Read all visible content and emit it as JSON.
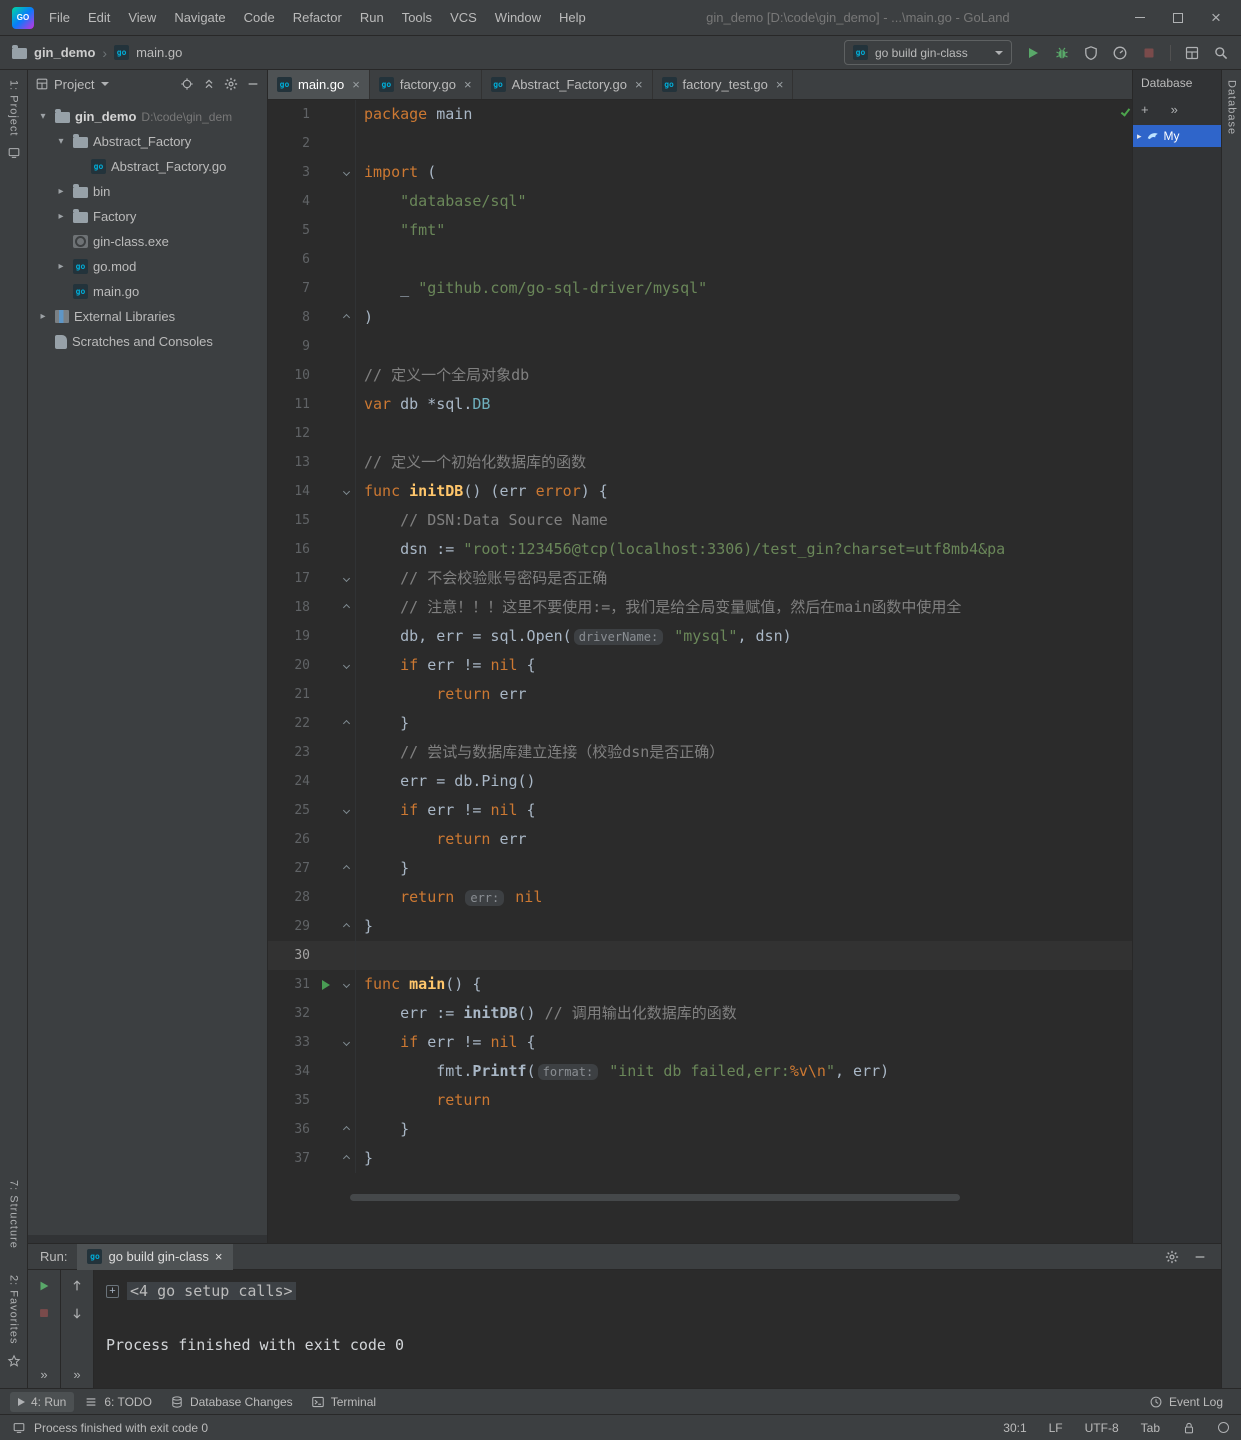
{
  "titlebar": {
    "menu": [
      "File",
      "Edit",
      "View",
      "Navigate",
      "Code",
      "Refactor",
      "Run",
      "Tools",
      "VCS",
      "Window",
      "Help"
    ],
    "title": "gin_demo [D:\\code\\gin_demo] - ...\\main.go - GoLand"
  },
  "toolbar": {
    "project_crumb": "gin_demo",
    "file_crumb": "main.go",
    "run_config": "go build gin-class"
  },
  "stripes": {
    "left_top": "1: Project",
    "left_structure": "7: Structure",
    "left_favorites": "2: Favorites",
    "right_database": "Database"
  },
  "project": {
    "header": "Project",
    "items": [
      {
        "label": "gin_demo",
        "hint": "D:\\code\\gin_dem",
        "icon": "folder",
        "arrow": "down",
        "indent": 0,
        "bold": true
      },
      {
        "label": "Abstract_Factory",
        "icon": "folder",
        "arrow": "down",
        "indent": 1
      },
      {
        "label": "Abstract_Factory.go",
        "icon": "gofile",
        "arrow": "none",
        "indent": 2
      },
      {
        "label": "bin",
        "icon": "folder",
        "arrow": "right",
        "indent": 1
      },
      {
        "label": "Factory",
        "icon": "folder",
        "arrow": "right",
        "indent": 1
      },
      {
        "label": "gin-class.exe",
        "icon": "exe",
        "arrow": "none",
        "indent": 1
      },
      {
        "label": "go.mod",
        "icon": "gomod",
        "arrow": "right",
        "indent": 1
      },
      {
        "label": "main.go",
        "icon": "gofile",
        "arrow": "none",
        "indent": 1
      },
      {
        "label": "External Libraries",
        "icon": "lib",
        "arrow": "right",
        "indent": 0
      },
      {
        "label": "Scratches and Consoles",
        "icon": "scratch",
        "arrow": "none",
        "indent": 0
      }
    ]
  },
  "editor": {
    "tabs": [
      {
        "label": "main.go",
        "active": true
      },
      {
        "label": "factory.go",
        "active": false
      },
      {
        "label": "Abstract_Factory.go",
        "active": false
      },
      {
        "label": "factory_test.go",
        "active": false
      }
    ],
    "lines": [
      {
        "n": 1,
        "seg": [
          [
            "kw",
            "package"
          ],
          [
            "plain",
            " main"
          ]
        ]
      },
      {
        "n": 2,
        "seg": []
      },
      {
        "n": 3,
        "fold": "start",
        "seg": [
          [
            "kw",
            "import"
          ],
          [
            "plain",
            " ("
          ]
        ]
      },
      {
        "n": 4,
        "seg": [
          [
            "plain",
            "    "
          ],
          [
            "str",
            "\"database/sql\""
          ]
        ]
      },
      {
        "n": 5,
        "seg": [
          [
            "plain",
            "    "
          ],
          [
            "str",
            "\"fmt\""
          ]
        ]
      },
      {
        "n": 6,
        "seg": []
      },
      {
        "n": 7,
        "seg": [
          [
            "plain",
            "    _ "
          ],
          [
            "str",
            "\"github.com/go-sql-driver/mysql\""
          ]
        ]
      },
      {
        "n": 8,
        "fold": "end",
        "seg": [
          [
            "plain",
            ")"
          ]
        ]
      },
      {
        "n": 9,
        "seg": []
      },
      {
        "n": 10,
        "seg": [
          [
            "com",
            "// 定义一个全局对象db"
          ]
        ]
      },
      {
        "n": 11,
        "seg": [
          [
            "kw",
            "var"
          ],
          [
            "plain",
            " db *sql."
          ],
          [
            "typ",
            "DB"
          ]
        ]
      },
      {
        "n": 12,
        "seg": []
      },
      {
        "n": 13,
        "seg": [
          [
            "com",
            "// 定义一个初始化数据库的函数"
          ]
        ]
      },
      {
        "n": 14,
        "fold": "start",
        "seg": [
          [
            "kw",
            "func"
          ],
          [
            "plain",
            " "
          ],
          [
            "fn",
            "initDB"
          ],
          [
            "plain",
            "() (err "
          ],
          [
            "kw",
            "error"
          ],
          [
            "plain",
            ") {"
          ]
        ]
      },
      {
        "n": 15,
        "seg": [
          [
            "plain",
            "    "
          ],
          [
            "com",
            "// DSN:Data Source Name"
          ]
        ]
      },
      {
        "n": 16,
        "seg": [
          [
            "plain",
            "    dsn := "
          ],
          [
            "str",
            "\"root:123456@tcp(localhost:3306)/test_gin?charset=utf8mb4&pa"
          ]
        ]
      },
      {
        "n": 17,
        "fold": "start",
        "seg": [
          [
            "plain",
            "    "
          ],
          [
            "com",
            "// 不会校验账号密码是否正确"
          ]
        ]
      },
      {
        "n": 18,
        "fold": "end",
        "seg": [
          [
            "plain",
            "    "
          ],
          [
            "com",
            "// 注意！！！这里不要使用:=，我们是给全局变量赋值，然后在main函数中使用全"
          ]
        ]
      },
      {
        "n": 19,
        "seg": [
          [
            "plain",
            "    db, err = sql.Open("
          ],
          [
            "hint",
            "driverName:"
          ],
          [
            "plain",
            " "
          ],
          [
            "str",
            "\"mysql\""
          ],
          [
            "plain",
            ", dsn)"
          ]
        ]
      },
      {
        "n": 20,
        "fold": "start",
        "seg": [
          [
            "plain",
            "    "
          ],
          [
            "kw",
            "if"
          ],
          [
            "plain",
            " err != "
          ],
          [
            "kw",
            "nil"
          ],
          [
            "plain",
            " {"
          ]
        ]
      },
      {
        "n": 21,
        "seg": [
          [
            "plain",
            "        "
          ],
          [
            "kw",
            "return"
          ],
          [
            "plain",
            " err"
          ]
        ]
      },
      {
        "n": 22,
        "fold": "end",
        "seg": [
          [
            "plain",
            "    }"
          ]
        ]
      },
      {
        "n": 23,
        "seg": [
          [
            "plain",
            "    "
          ],
          [
            "com",
            "// 尝试与数据库建立连接（校验dsn是否正确）"
          ]
        ]
      },
      {
        "n": 24,
        "seg": [
          [
            "plain",
            "    err = db.Ping()"
          ]
        ]
      },
      {
        "n": 25,
        "fold": "start",
        "seg": [
          [
            "plain",
            "    "
          ],
          [
            "kw",
            "if"
          ],
          [
            "plain",
            " err != "
          ],
          [
            "kw",
            "nil"
          ],
          [
            "plain",
            " {"
          ]
        ]
      },
      {
        "n": 26,
        "seg": [
          [
            "plain",
            "        "
          ],
          [
            "kw",
            "return"
          ],
          [
            "plain",
            " err"
          ]
        ]
      },
      {
        "n": 27,
        "fold": "end",
        "seg": [
          [
            "plain",
            "    }"
          ]
        ]
      },
      {
        "n": 28,
        "seg": [
          [
            "plain",
            "    "
          ],
          [
            "kw",
            "return"
          ],
          [
            "plain",
            " "
          ],
          [
            "hint",
            "err:"
          ],
          [
            "plain",
            " "
          ],
          [
            "kw",
            "nil"
          ]
        ]
      },
      {
        "n": 29,
        "fold": "end",
        "seg": [
          [
            "plain",
            "}"
          ]
        ]
      },
      {
        "n": 30,
        "caret": true,
        "seg": []
      },
      {
        "n": 31,
        "fold": "start",
        "run": true,
        "seg": [
          [
            "kw",
            "func"
          ],
          [
            "plain",
            " "
          ],
          [
            "fn",
            "main"
          ],
          [
            "plain",
            "() {"
          ]
        ]
      },
      {
        "n": 32,
        "seg": [
          [
            "plain",
            "    err := "
          ],
          [
            "call",
            "initDB"
          ],
          [
            "plain",
            "() "
          ],
          [
            "com",
            "// 调用输出化数据库的函数"
          ]
        ]
      },
      {
        "n": 33,
        "fold": "start",
        "seg": [
          [
            "plain",
            "    "
          ],
          [
            "kw",
            "if"
          ],
          [
            "plain",
            " err != "
          ],
          [
            "kw",
            "nil"
          ],
          [
            "plain",
            " {"
          ]
        ]
      },
      {
        "n": 34,
        "seg": [
          [
            "plain",
            "        fmt."
          ],
          [
            "call",
            "Printf"
          ],
          [
            "plain",
            "("
          ],
          [
            "hint",
            "format:"
          ],
          [
            "plain",
            " "
          ],
          [
            "str",
            "\"init db failed,err:"
          ],
          [
            "esc",
            "%v"
          ],
          [
            "esc",
            "\\n"
          ],
          [
            "str",
            "\""
          ],
          [
            "plain",
            ", err)"
          ]
        ]
      },
      {
        "n": 35,
        "seg": [
          [
            "plain",
            "        "
          ],
          [
            "kw",
            "return"
          ]
        ]
      },
      {
        "n": 36,
        "fold": "end",
        "seg": [
          [
            "plain",
            "    }"
          ]
        ]
      },
      {
        "n": 37,
        "fold": "end",
        "seg": [
          [
            "plain",
            "}"
          ]
        ]
      }
    ]
  },
  "database": {
    "header": "Database",
    "selected_item": "My"
  },
  "run_panel": {
    "label": "Run:",
    "tab": "go build gin-class",
    "console": [
      {
        "type": "fold",
        "text": "<4 go setup calls>"
      },
      {
        "type": "plain",
        "text": "Process finished with exit code 0"
      }
    ]
  },
  "bottom_bar": {
    "left": [
      {
        "label": "4: Run",
        "icon": "run",
        "active": true
      },
      {
        "label": "6: TODO",
        "icon": "todo",
        "active": false
      },
      {
        "label": "Database Changes",
        "icon": "db",
        "active": false
      },
      {
        "label": "Terminal",
        "icon": "terminal",
        "active": false
      }
    ],
    "right": [
      {
        "label": "Event Log",
        "icon": "event",
        "active": false
      }
    ]
  },
  "status_bar": {
    "message": "Process finished with exit code 0",
    "caret": "30:1",
    "line_ending": "LF",
    "encoding": "UTF-8",
    "indent": "Tab"
  },
  "colors": {
    "accent_green": "#499C54",
    "selection_blue": "#2F65CA",
    "keyword": "#CC7832",
    "string": "#6A8759",
    "comment": "#808080",
    "function": "#FFC66B"
  }
}
